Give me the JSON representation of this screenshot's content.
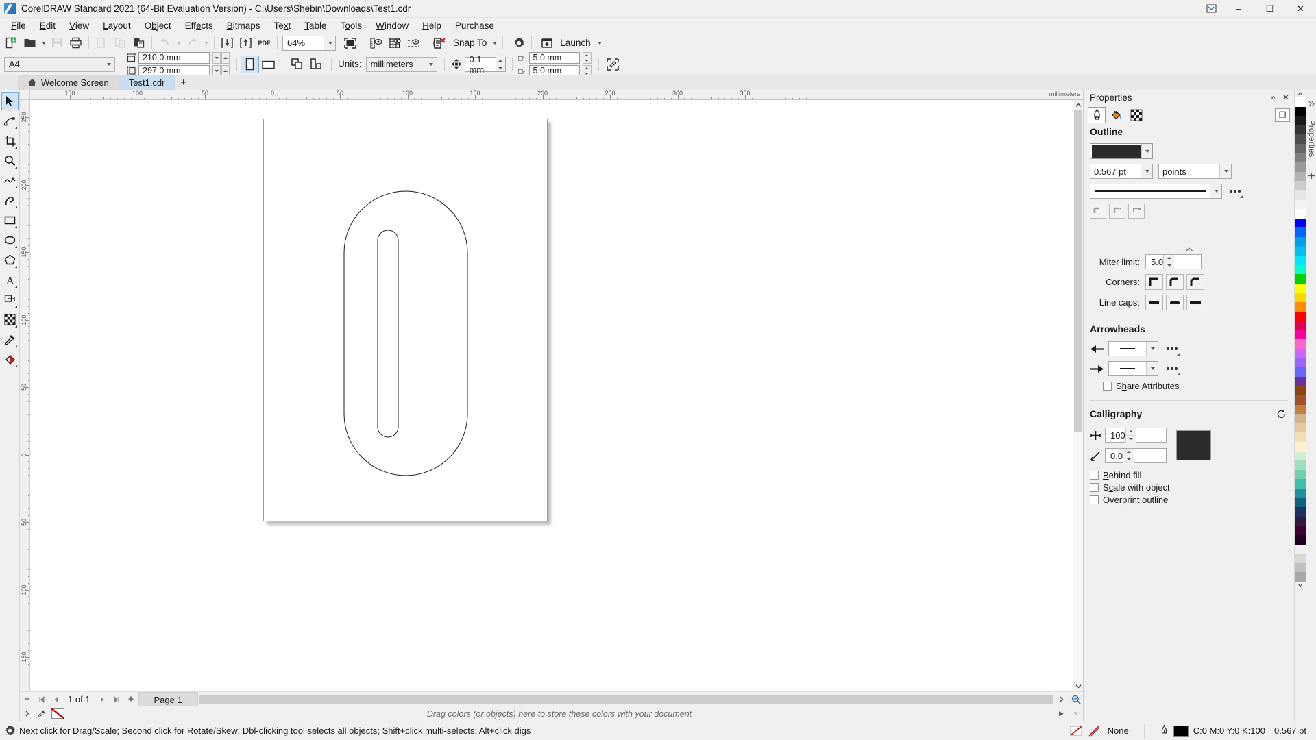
{
  "titlebar": {
    "title": "CorelDRAW Standard 2021 (64-Bit Evaluation Version) - C:\\Users\\Shebin\\Downloads\\Test1.cdr",
    "restore_app": "❐",
    "minimize": "–",
    "maximize": "☐",
    "close": "✕"
  },
  "menubar": {
    "items": [
      {
        "pre": "",
        "key": "F",
        "post": "ile"
      },
      {
        "pre": "",
        "key": "E",
        "post": "dit"
      },
      {
        "pre": "",
        "key": "V",
        "post": "iew"
      },
      {
        "pre": "",
        "key": "L",
        "post": "ayout"
      },
      {
        "pre": "O",
        "key": "b",
        "post": "ject"
      },
      {
        "pre": "Eff",
        "key": "e",
        "post": "cts"
      },
      {
        "pre": "",
        "key": "B",
        "post": "itmaps"
      },
      {
        "pre": "Te",
        "key": "x",
        "post": "t"
      },
      {
        "pre": "",
        "key": "T",
        "post": "able"
      },
      {
        "pre": "T",
        "key": "o",
        "post": "ols"
      },
      {
        "pre": "",
        "key": "W",
        "post": "indow"
      },
      {
        "pre": "",
        "key": "H",
        "post": "elp"
      },
      {
        "pre": "Purchase",
        "key": "",
        "post": ""
      }
    ]
  },
  "toolbar1": {
    "zoom_value": "64%",
    "snap_to_label": "Snap To",
    "launch_label": "Launch",
    "pdf_label": "PDF",
    "buttons": [
      "new-document",
      "open-document",
      "save-document",
      "print-document",
      "cut",
      "copy",
      "paste",
      "undo",
      "redo",
      "import",
      "export",
      "publish-to-pdf",
      "zoom-level",
      "full-screen-preview",
      "show-rulers",
      "show-grid",
      "show-guidelines",
      "snap-to",
      "options",
      "launch"
    ]
  },
  "propertybar": {
    "page_preset": "A4",
    "page_width": "210.0 mm",
    "page_height": "297.0 mm",
    "units_label": "Units:",
    "units_value": "millimeters",
    "nudge_value": "0.1 mm",
    "duplicate_x": "5.0 mm",
    "duplicate_y": "5.0 mm"
  },
  "tabs": {
    "welcome_label": "Welcome Screen",
    "document_label": "Test1.cdr",
    "add_label": "+"
  },
  "toolbox": {
    "tools": [
      {
        "name": "pick-tool",
        "glyph": "pick",
        "selected": true
      },
      {
        "name": "shape-tool",
        "glyph": "shape",
        "selected": false
      },
      {
        "name": "crop-tool",
        "glyph": "crop",
        "selected": false
      },
      {
        "name": "zoom-tool",
        "glyph": "zoom",
        "selected": false
      },
      {
        "name": "freehand-tool",
        "glyph": "freehand",
        "selected": false
      },
      {
        "name": "artistic-media-tool",
        "glyph": "artistic",
        "selected": false
      },
      {
        "name": "rectangle-tool",
        "glyph": "rect",
        "selected": false
      },
      {
        "name": "ellipse-tool",
        "glyph": "ellipse",
        "selected": false
      },
      {
        "name": "polygon-tool",
        "glyph": "polygon",
        "selected": false
      },
      {
        "name": "text-tool",
        "glyph": "text",
        "selected": false
      },
      {
        "name": "parallel-dimension-tool",
        "glyph": "dimension",
        "selected": false
      },
      {
        "name": "transparency-tool",
        "glyph": "transparency",
        "selected": false
      },
      {
        "name": "color-eyedropper-tool",
        "glyph": "eyedropper",
        "selected": false
      },
      {
        "name": "interactive-fill-tool",
        "glyph": "fill",
        "selected": false
      }
    ]
  },
  "rulers": {
    "unit_label": "millimeters",
    "h_ticks": [
      "150",
      "100",
      "50",
      "0",
      "50",
      "100",
      "150",
      "200",
      "250",
      "300",
      "350"
    ],
    "v_ticks": [
      "250",
      "200",
      "150",
      "100",
      "50",
      "0",
      "50",
      "100",
      "150"
    ]
  },
  "pagenav": {
    "add_page_left": "+",
    "first": "⏮",
    "prev": "◀",
    "next": "▶",
    "last": "⏭",
    "add_page_right": "+",
    "counter": "1 of 1",
    "page_tab": "Page 1"
  },
  "palette": {
    "hint": "Drag colors (or objects) here to store these colors with your document",
    "expand_left": "▶",
    "expand_right": "»"
  },
  "statusbar": {
    "hint": "Next click for Drag/Scale; Second click for Rotate/Skew; Dbl-clicking tool selects all objects; Shift+click multi-selects; Alt+click digs",
    "fill_label": "None",
    "outline_color": "C:0 M:0 Y:0 K:100",
    "outline_width": "0.567 pt"
  },
  "docker": {
    "title": "Properties",
    "collapse_icon": "»",
    "close_icon": "✕",
    "tabs": [
      {
        "name": "outline-tab",
        "icon": "pen-nib",
        "selected": true
      },
      {
        "name": "fill-tab",
        "icon": "paint-bucket",
        "selected": false
      },
      {
        "name": "transparency-tab",
        "icon": "checker",
        "selected": false
      }
    ],
    "restore_btn": "❐",
    "outline": {
      "heading": "Outline",
      "color": "#2b2b2b",
      "width_value": "0.567 pt",
      "width_units": "points",
      "style_value": "",
      "more_label": "•••",
      "miter_label": "Miter limit:",
      "miter_value": "5.0",
      "corners_label": "Corners:",
      "line_caps_label": "Line caps:"
    },
    "arrowheads": {
      "heading": "Arrowheads",
      "start_value": "",
      "end_value": "",
      "share_attributes_pre": "S",
      "share_attributes_key": "h",
      "share_attributes_post": "are Attributes"
    },
    "calligraphy": {
      "heading": "Calligraphy",
      "reset_icon": "↺",
      "stretch_value": "100",
      "angle_value": "0.0",
      "swatch_color": "#2b2b2b",
      "behind_fill_pre": "",
      "behind_fill_key": "B",
      "behind_fill_post": "ehind fill",
      "scale_with_object_pre": "S",
      "scale_with_object_key": "c",
      "scale_with_object_post": "ale with object",
      "overprint_pre": "",
      "overprint_key": "O",
      "overprint_post": "verprint outline"
    }
  },
  "rail": {
    "label": "Properties"
  },
  "colors": {
    "accent": "#0b7dc4",
    "tab_active": "#c9dff0",
    "swatches": [
      "#ffffff",
      "#000000",
      "#1a1a1a",
      "#333333",
      "#4d4d4d",
      "#666666",
      "#808080",
      "#999999",
      "#b3b3b3",
      "#cccccc",
      "#e6e6e6",
      "#f2f2f2",
      "#ffffff",
      "#0000ff",
      "#0066ff",
      "#00a0e9",
      "#00c0f0",
      "#00e5ff",
      "#00ffcc",
      "#00d000",
      "#ffff00",
      "#ffd700",
      "#ff8c00",
      "#ff0000",
      "#e00050",
      "#ff00a0",
      "#ff66cc",
      "#cc66ff",
      "#9966ff",
      "#6666ff",
      "#663399",
      "#8b4513",
      "#a0522d",
      "#c08040",
      "#d2b48c",
      "#e8c8a0",
      "#f5deb3",
      "#fff0d0",
      "#d0f0d0",
      "#a0e0c0",
      "#70d0b0",
      "#40c0b0",
      "#2090a0",
      "#106080",
      "#203060",
      "#301840",
      "#400030",
      "#200020",
      "#f0f0f0",
      "#d8d8d8",
      "#c0c0c0",
      "#a8a8a8"
    ]
  }
}
